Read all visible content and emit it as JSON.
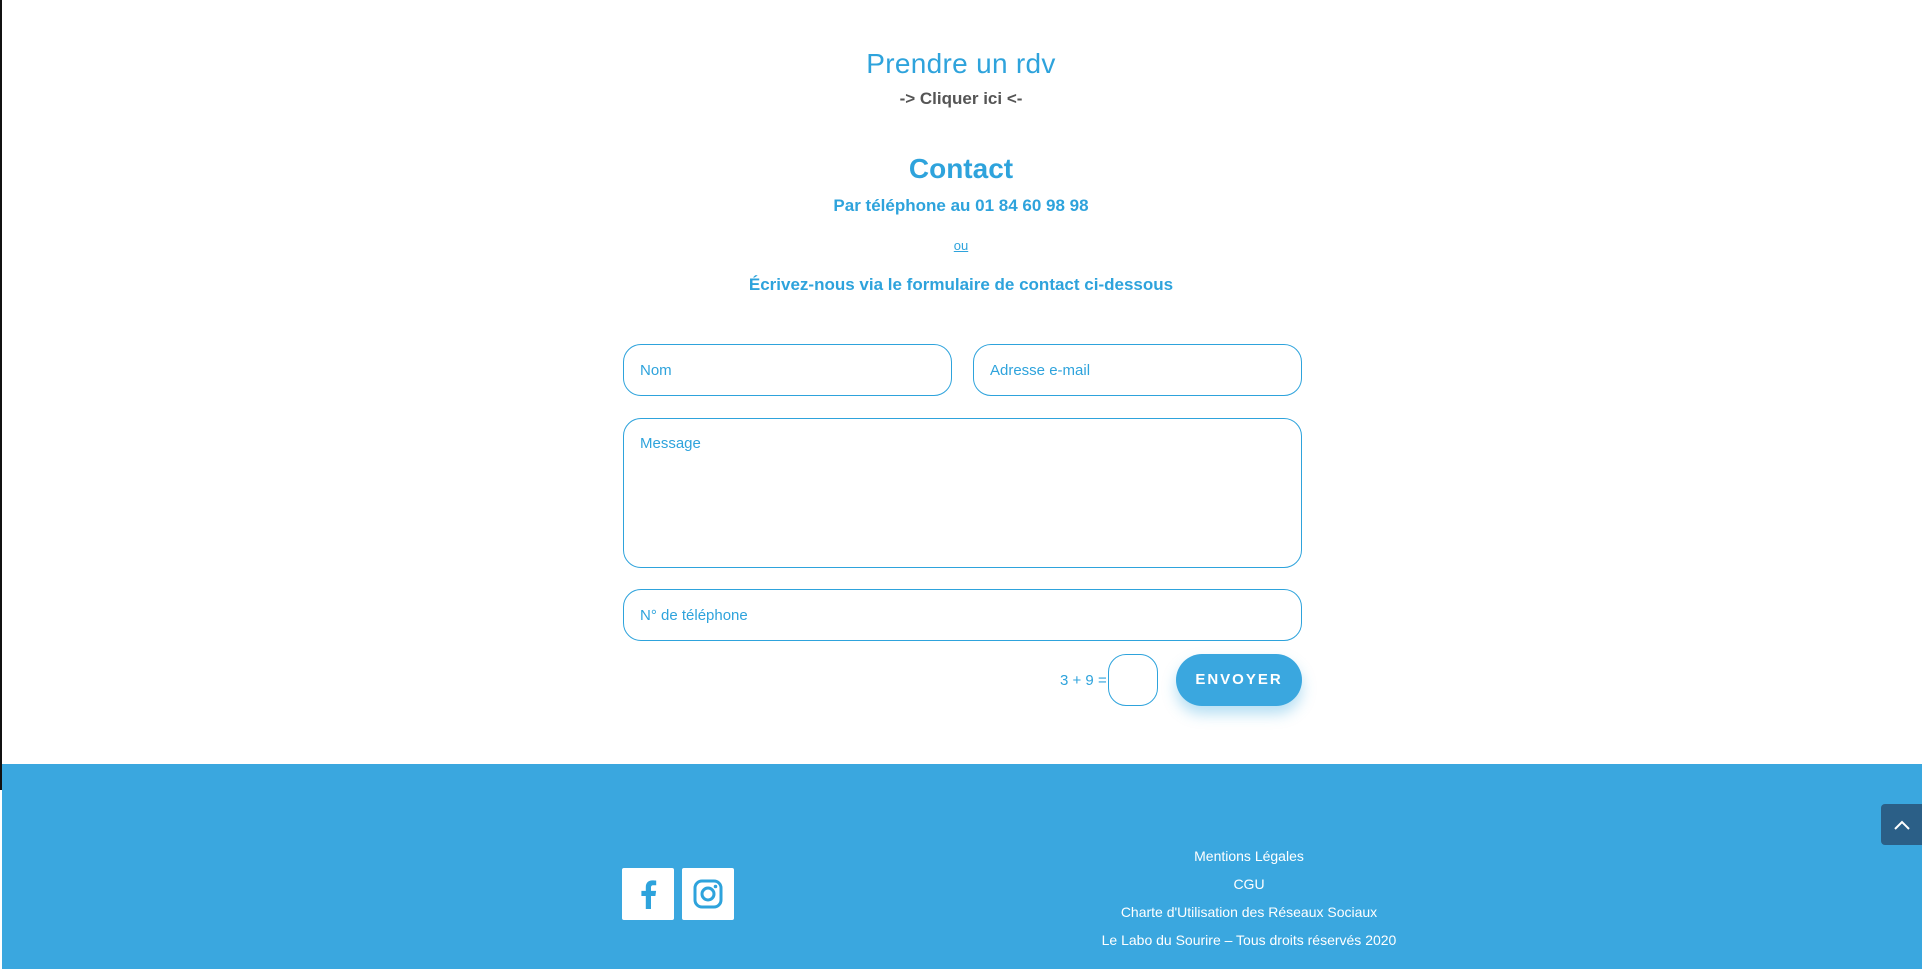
{
  "appointment": {
    "title": "Prendre un rdv",
    "link": "-> Cliquer ici <-"
  },
  "contact": {
    "title": "Contact",
    "phone_text": "Par téléphone au  01 84 60 98 98",
    "or_text": "ou",
    "write_text": "Écrivez-nous via le formulaire de contact ci-dessous"
  },
  "form": {
    "name_placeholder": "Nom",
    "email_placeholder": "Adresse e-mail",
    "message_placeholder": "Message",
    "phone_placeholder": "N° de téléphone",
    "captcha_label": "3 + 9 =",
    "captcha_value": "",
    "submit_label": "ENVOYER"
  },
  "footer": {
    "social": [
      "facebook-icon",
      "instagram-icon"
    ],
    "links": [
      "Mentions Légales",
      "CGU",
      "Charte d'Utilisation des Réseaux Sociaux",
      "Le Labo du Sourire – Tous droits réservés 2020"
    ]
  },
  "colors": {
    "accent": "#2ea3dc",
    "footer_bg": "#3aa7df",
    "scroll_top_bg": "#2b5f87",
    "muted_text": "#555555"
  },
  "icons": {
    "scroll_top": "chevron-up-icon"
  }
}
